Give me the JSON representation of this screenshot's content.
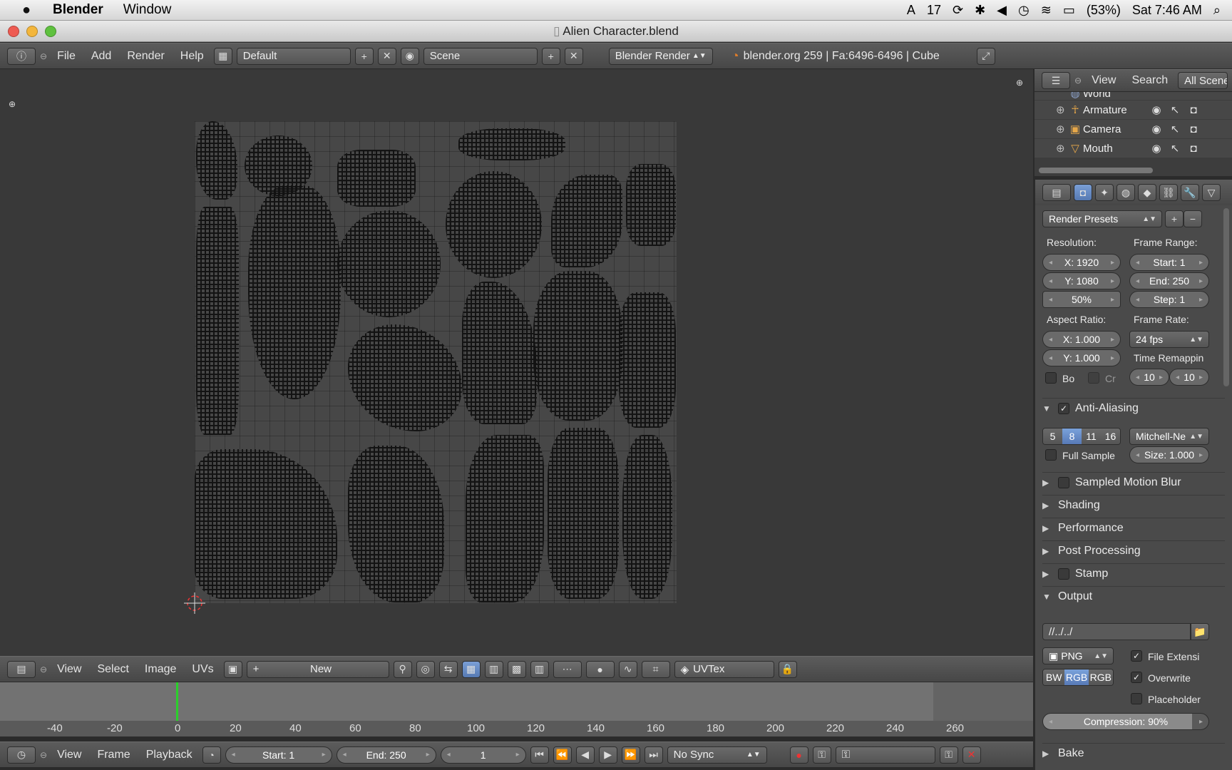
{
  "menubar": {
    "app_name": "Blender",
    "items": [
      "Window"
    ],
    "status": {
      "adobe_badge": "17",
      "battery": "(53%)",
      "clock": "Sat 7:46 AM"
    }
  },
  "window": {
    "title": "Alien Character.blend"
  },
  "info_header": {
    "menus": [
      "File",
      "Add",
      "Render",
      "Help"
    ],
    "layout": "Default",
    "scene": "Scene",
    "engine": "Blender Render",
    "stats": "blender.org 259 | Fa:6496-6496 | Cube"
  },
  "outliner": {
    "view": "View",
    "search": "Search",
    "filter": "All Scene",
    "rows": [
      {
        "name": "World"
      },
      {
        "name": "Armature"
      },
      {
        "name": "Camera"
      },
      {
        "name": "Mouth"
      }
    ]
  },
  "properties": {
    "render_presets": "Render Presets",
    "resolution_label": "Resolution:",
    "res_x": "X: 1920",
    "res_y": "Y: 1080",
    "res_pct": "50%",
    "frame_range_label": "Frame Range:",
    "start": "Start: 1",
    "end": "End: 250",
    "step": "Step: 1",
    "aspect_label": "Aspect Ratio:",
    "aspect_x": "X: 1.000",
    "aspect_y": "Y: 1.000",
    "frame_rate_label": "Frame Rate:",
    "fps": "24 fps",
    "time_remap_label": "Time Remappin",
    "remap_old": "10",
    "remap_new": "10",
    "border": "Bo",
    "crop": "Cr",
    "aa_label": "Anti-Aliasing",
    "aa_samples": [
      "5",
      "8",
      "11",
      "16"
    ],
    "aa_filter": "Mitchell-Ne",
    "full_sample": "Full Sample",
    "aa_size": "Size: 1.000",
    "sections": [
      "Sampled Motion Blur",
      "Shading",
      "Performance",
      "Post Processing",
      "Stamp",
      "Output"
    ],
    "output_path": "//../../",
    "format": "PNG",
    "file_ext": "File Extensi",
    "overwrite": "Overwrite",
    "placeholder": "Placeholder",
    "color_modes": [
      "BW",
      "RGB",
      "RGB"
    ],
    "compression": "Compression: 90%",
    "bake": "Bake"
  },
  "uv_header": {
    "menus": [
      "View",
      "Select",
      "Image",
      "UVs"
    ],
    "new": "New",
    "uvtex": "UVTex"
  },
  "timeline": {
    "ticks": [
      "-40",
      "-20",
      "0",
      "20",
      "40",
      "60",
      "80",
      "100",
      "120",
      "140",
      "160",
      "180",
      "200",
      "220",
      "240",
      "260"
    ],
    "menus": [
      "View",
      "Frame",
      "Playback"
    ],
    "start": "Start: 1",
    "end": "End: 250",
    "current": "1",
    "sync": "No Sync"
  },
  "colors": {
    "accent": "#5779b6",
    "playhead": "#2bd02b"
  }
}
